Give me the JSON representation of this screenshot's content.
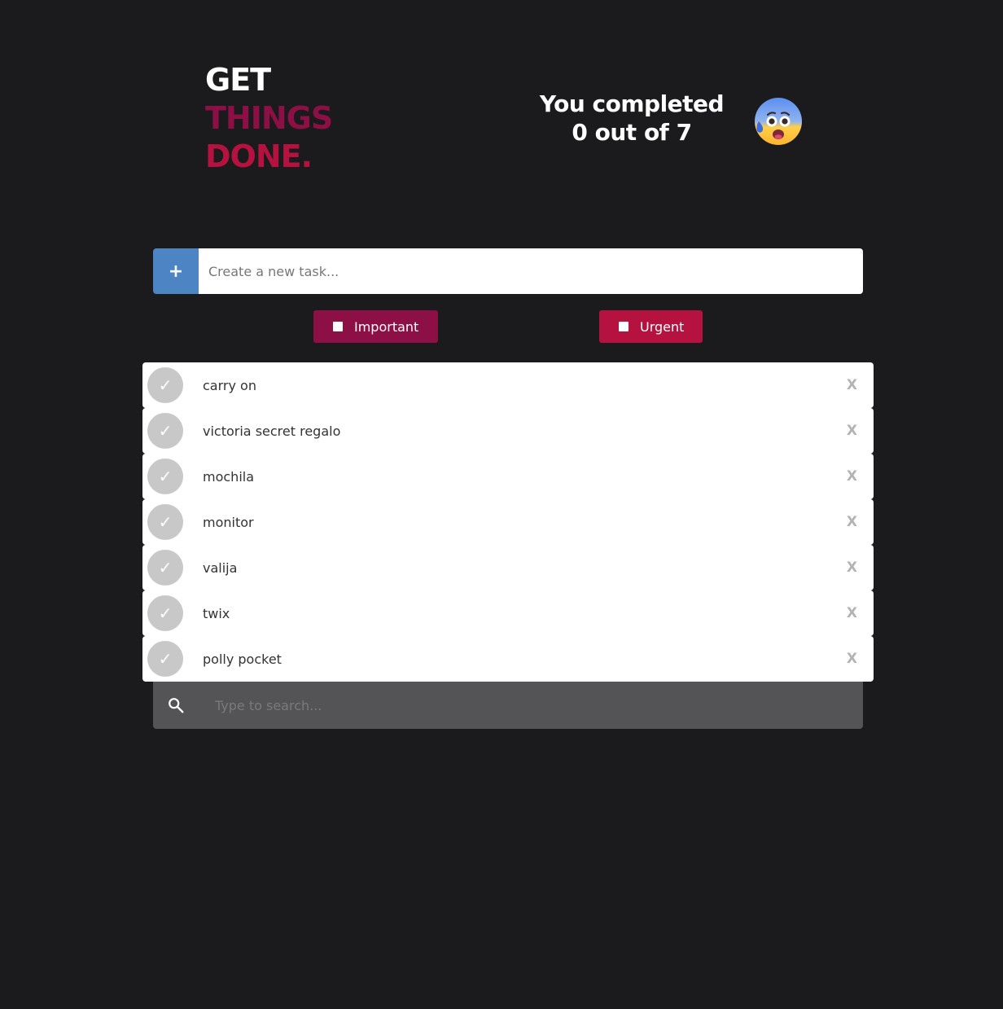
{
  "header": {
    "title_line1": "GET",
    "title_line2": "THINGS",
    "title_line3": "DONE.",
    "progress_line1": "You completed",
    "progress_line2": "0 out of 7",
    "completed": 0,
    "total": 7,
    "emoji_icon": "anxious-face-icon"
  },
  "new_task": {
    "add_icon": "plus-icon",
    "add_label": "+",
    "placeholder": "Create a new task..."
  },
  "flags": {
    "important_label": "Important",
    "urgent_label": "Urgent"
  },
  "tasks": [
    {
      "text": "carry on",
      "completed": false
    },
    {
      "text": "victoria secret regalo",
      "completed": false
    },
    {
      "text": "mochila",
      "completed": false
    },
    {
      "text": "monitor",
      "completed": false
    },
    {
      "text": "valija",
      "completed": false
    },
    {
      "text": "twix",
      "completed": false
    },
    {
      "text": "polly pocket",
      "completed": false
    }
  ],
  "task_ui": {
    "check_glyph": "✓",
    "delete_glyph": "X"
  },
  "search": {
    "placeholder": "Type to search..."
  },
  "colors": {
    "background": "#1b1b1d",
    "important": "#8c0f45",
    "urgent": "#b5123f",
    "add_button": "#4d84c4",
    "search_bg": "#545456"
  }
}
